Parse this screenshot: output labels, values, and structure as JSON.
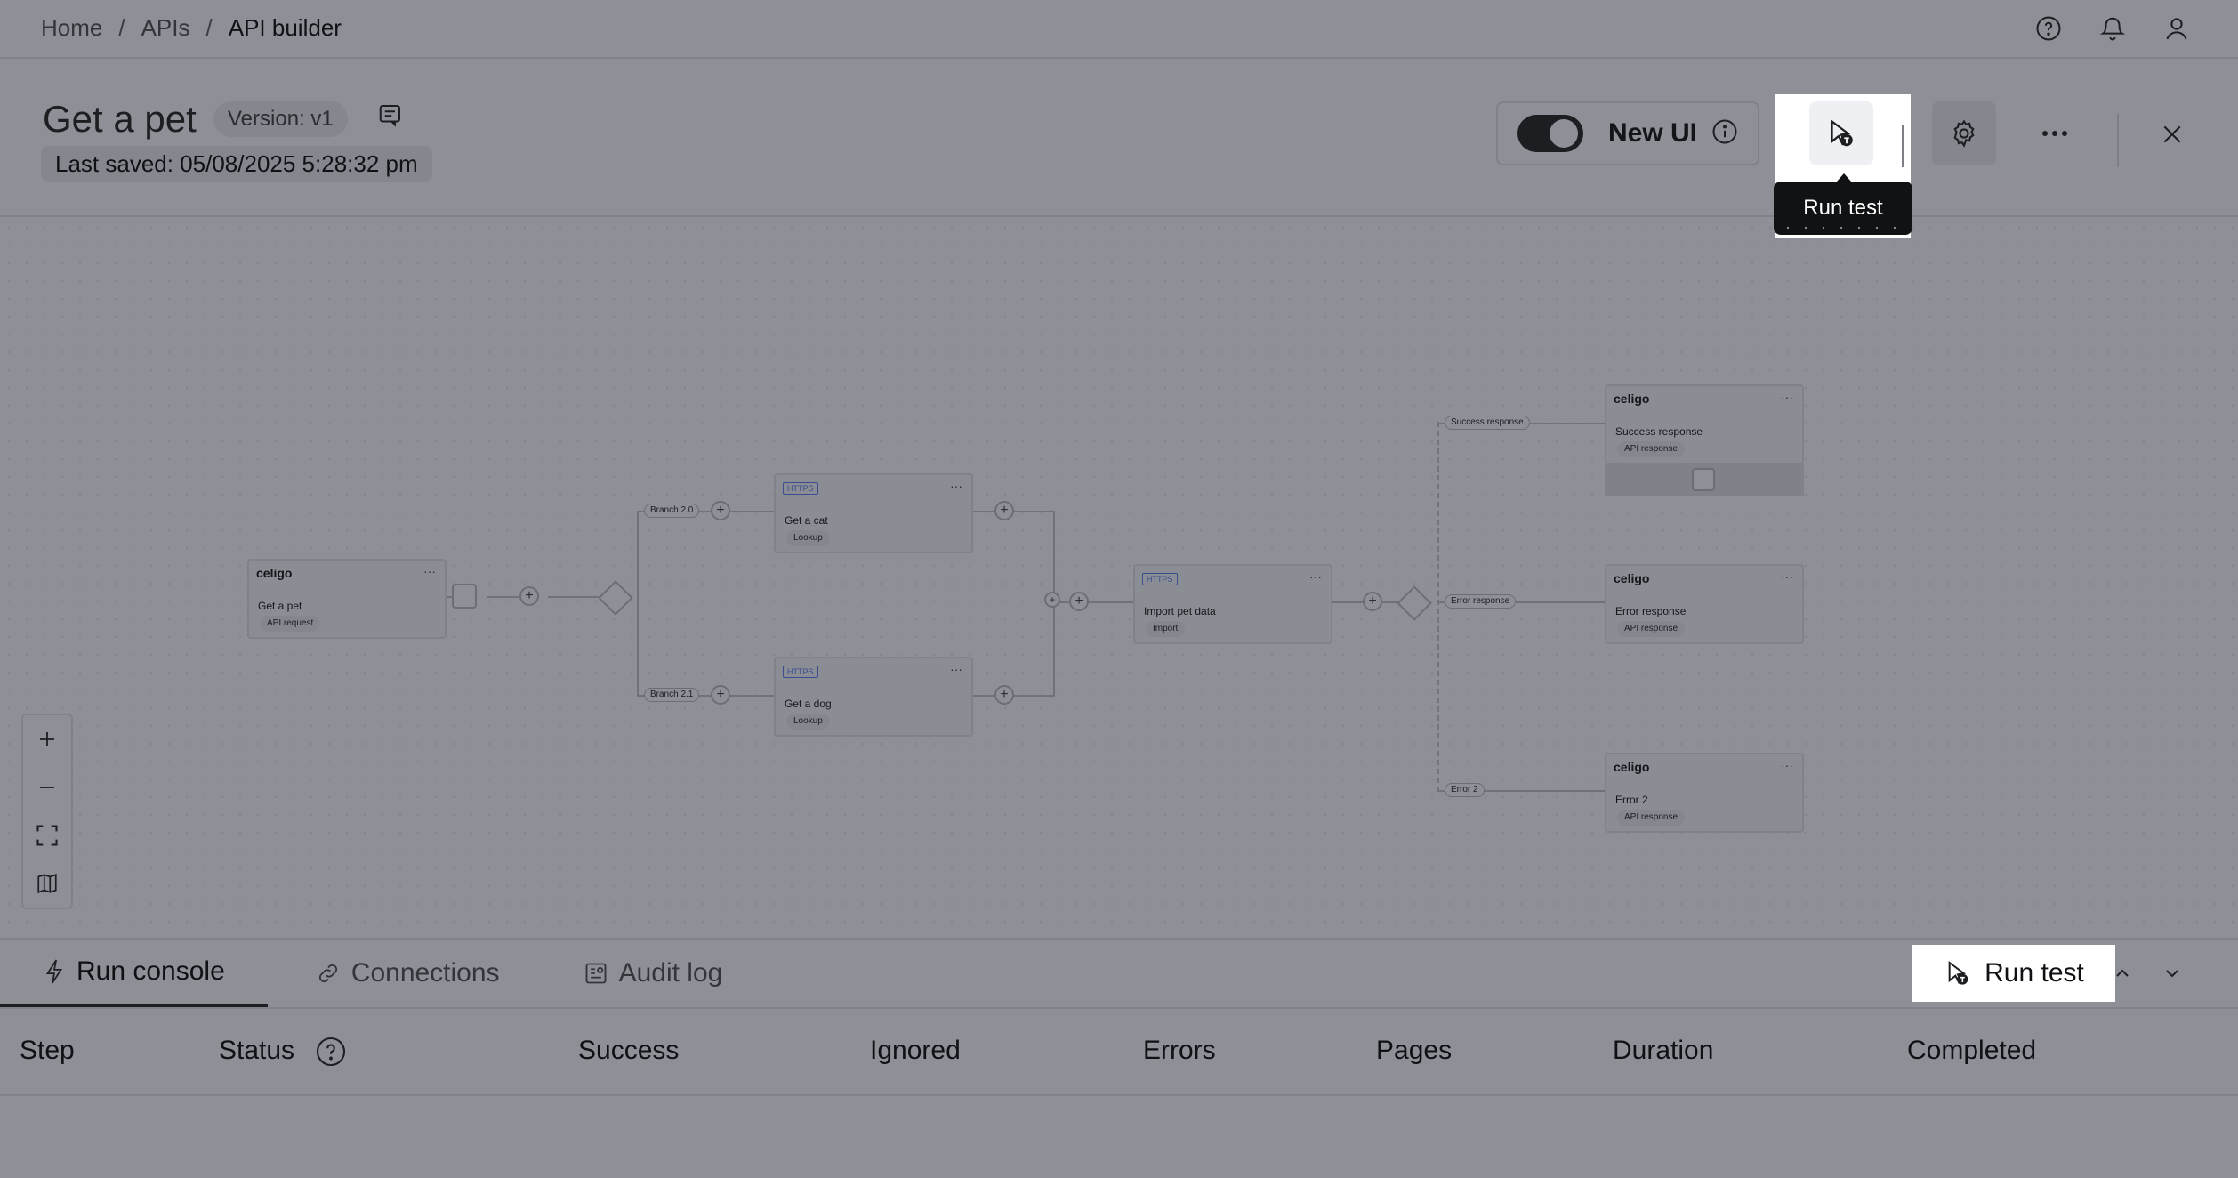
{
  "breadcrumb": {
    "home": "Home",
    "sep1": "/",
    "apis": "APIs",
    "sep2": "/",
    "current": "API builder"
  },
  "header": {
    "title": "Get a pet",
    "version": "Version: v1",
    "last_saved": "Last saved: 05/08/2025 5:28:32 pm",
    "new_ui_label": "New UI",
    "run_test_tooltip": "Run test",
    "more_label": "···"
  },
  "flow": {
    "start": {
      "brand": "celigo",
      "name": "Get a pet",
      "type": "API request"
    },
    "branch_a": "Branch 2.0",
    "branch_b": "Branch 2.1",
    "cat": {
      "badge": "HTTPS",
      "name": "Get a cat",
      "type": "Lookup"
    },
    "dog": {
      "badge": "HTTPS",
      "name": "Get a dog",
      "type": "Lookup"
    },
    "import": {
      "badge": "HTTPS",
      "name": "Import pet data",
      "type": "Import"
    },
    "success_edge": "Success response",
    "error_edge": "Error response",
    "error2_edge": "Error 2",
    "success": {
      "brand": "celigo",
      "name": "Success response",
      "type": "API response"
    },
    "error": {
      "brand": "celigo",
      "name": "Error response",
      "type": "API response"
    },
    "error2": {
      "brand": "celigo",
      "name": "Error 2",
      "type": "API response"
    },
    "dots": "···",
    "plus": "+"
  },
  "bottom": {
    "tabs": [
      {
        "label": "Run console"
      },
      {
        "label": "Connections"
      },
      {
        "label": "Audit log"
      }
    ],
    "run_test": "Run test",
    "columns": [
      "Step",
      "Status",
      "Success",
      "Ignored",
      "Errors",
      "Pages",
      "Duration",
      "Completed"
    ]
  }
}
